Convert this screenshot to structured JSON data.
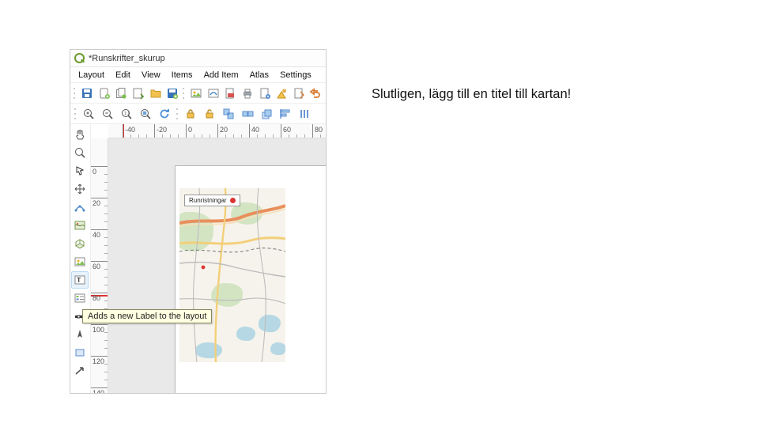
{
  "window": {
    "title": "*Runskrifter_skurup"
  },
  "menu": {
    "items": [
      "Layout",
      "Edit",
      "View",
      "Items",
      "Add Item",
      "Atlas",
      "Settings"
    ]
  },
  "ruler_h": {
    "ticks": [
      -40,
      -20,
      0,
      20,
      40,
      60,
      80
    ]
  },
  "ruler_v": {
    "ticks": [
      0,
      20,
      40,
      60,
      80,
      100,
      120,
      140
    ]
  },
  "legend": {
    "label": "Runristningar"
  },
  "tooltip": {
    "text": "Adds a new Label to the layout"
  },
  "caption": {
    "text": "Slutligen, lägg till en titel till kartan!"
  },
  "colors": {
    "accent": "#6a9a2d",
    "cursor": "#d33",
    "road_primary": "#e98f5b",
    "road_secondary": "#f3cf7a",
    "road_minor": "#c9c9c9",
    "water": "#b6d8e4",
    "rail": "#777"
  }
}
